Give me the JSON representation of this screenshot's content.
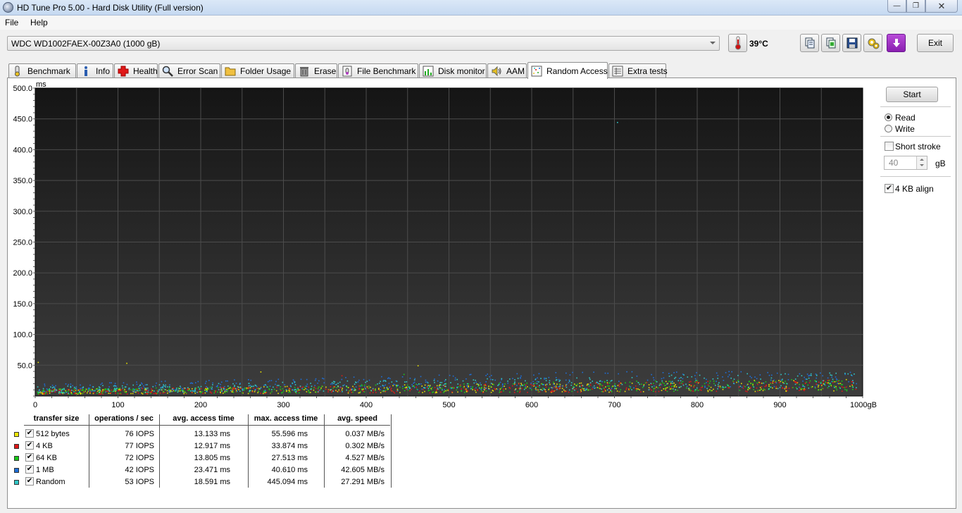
{
  "window": {
    "title": "HD Tune Pro 5.00 - Hard Disk Utility (Full version)",
    "minimize": "—",
    "maximize": "❐",
    "close": "✕"
  },
  "menu": {
    "file": "File",
    "help": "Help"
  },
  "toolbar": {
    "drive": "WDC WD1002FAEX-00Z3A0 (1000 gB)",
    "temperature": "39°C",
    "exit_label": "Exit",
    "buttons": [
      "copy-icon",
      "copy-screenshot-icon",
      "save-icon",
      "options-icon",
      "download-icon"
    ]
  },
  "tabs": [
    {
      "label": "Benchmark",
      "icon": "benchmark-icon"
    },
    {
      "label": "Info",
      "icon": "info-icon"
    },
    {
      "label": "Health",
      "icon": "health-icon"
    },
    {
      "label": "Error Scan",
      "icon": "error-scan-icon"
    },
    {
      "label": "Folder Usage",
      "icon": "folder-icon"
    },
    {
      "label": "Erase",
      "icon": "erase-icon"
    },
    {
      "label": "File Benchmark",
      "icon": "file-benchmark-icon"
    },
    {
      "label": "Disk monitor",
      "icon": "disk-monitor-icon"
    },
    {
      "label": "AAM",
      "icon": "speaker-icon"
    },
    {
      "label": "Random Access",
      "icon": "random-access-icon",
      "active": true
    },
    {
      "label": "Extra tests",
      "icon": "extra-tests-icon"
    }
  ],
  "controls": {
    "start": "Start",
    "read": "Read",
    "write": "Write",
    "mode": "Read",
    "short_stroke": "Short stroke",
    "short_stroke_checked": false,
    "stroke_value": "40",
    "stroke_unit": "gB",
    "align_4kb": "4 KB align",
    "align_4kb_checked": true
  },
  "chart_data": {
    "type": "scatter",
    "ylabel": "ms",
    "xunit": "gB",
    "xlim": [
      0,
      1000
    ],
    "ylim": [
      0,
      500
    ],
    "x_ticks": [
      "0",
      "100",
      "200",
      "300",
      "400",
      "500",
      "600",
      "700",
      "800",
      "900",
      "1000gB"
    ],
    "y_ticks": [
      "500.0",
      "450.0",
      "400.0",
      "350.0",
      "300.0",
      "250.0",
      "200.0",
      "150.0",
      "100.0",
      "50.0"
    ],
    "grid": true,
    "series": [
      {
        "name": "512 bytes",
        "color": "#e8e000",
        "avg_ms": 13.133,
        "max_ms": 55.596
      },
      {
        "name": "4 KB",
        "color": "#e01818",
        "avg_ms": 12.917,
        "max_ms": 33.874
      },
      {
        "name": "64 KB",
        "color": "#18c818",
        "avg_ms": 13.805,
        "max_ms": 27.513
      },
      {
        "name": "1 MB",
        "color": "#1e6fd8",
        "avg_ms": 23.471,
        "max_ms": 40.61
      },
      {
        "name": "Random",
        "color": "#30c8c8",
        "avg_ms": 18.591,
        "max_ms": 445.094
      }
    ]
  },
  "results": {
    "headers": [
      "transfer size",
      "operations / sec",
      "avg. access time",
      "max. access time",
      "avg. speed"
    ],
    "rows": [
      {
        "size": "512 bytes",
        "color": "#f0e800",
        "ops": "76 IOPS",
        "avg": "13.133 ms",
        "max": "55.596 ms",
        "speed": "0.037 MB/s",
        "checked": true
      },
      {
        "size": "4 KB",
        "color": "#e01818",
        "ops": "77 IOPS",
        "avg": "12.917 ms",
        "max": "33.874 ms",
        "speed": "0.302 MB/s",
        "checked": true
      },
      {
        "size": "64 KB",
        "color": "#18c818",
        "ops": "72 IOPS",
        "avg": "13.805 ms",
        "max": "27.513 ms",
        "speed": "4.527 MB/s",
        "checked": true
      },
      {
        "size": "1 MB",
        "color": "#1e6fd8",
        "ops": "42 IOPS",
        "avg": "23.471 ms",
        "max": "40.610 ms",
        "speed": "42.605 MB/s",
        "checked": true
      },
      {
        "size": "Random",
        "color": "#30c8c8",
        "ops": "53 IOPS",
        "avg": "18.591 ms",
        "max": "445.094 ms",
        "speed": "27.291 MB/s",
        "checked": true
      }
    ]
  }
}
